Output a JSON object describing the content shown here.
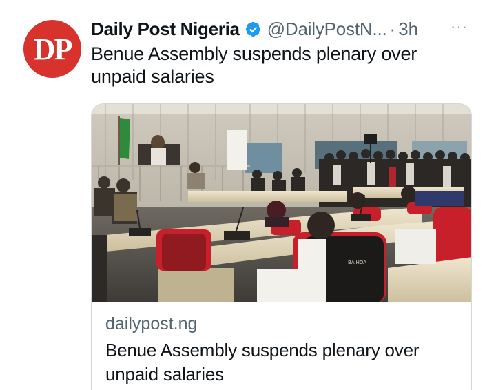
{
  "tweet": {
    "avatar_text": "DP",
    "display_name": "Daily Post Nigeria",
    "handle": "@DailyPostN...",
    "separator": "·",
    "time": "3h",
    "more": "···",
    "text": "Benue Assembly suspends plenary over unpaid salaries"
  },
  "card": {
    "domain": "dailypost.ng",
    "title": "Benue Assembly suspends plenary over unpaid salaries",
    "image_text": "BAIHOA"
  },
  "colors": {
    "avatar_bg": "#d8322c",
    "verified": "#1d9bf0",
    "secondary_text": "#536471",
    "chair_red": "#c8202a"
  },
  "icons": {
    "verified": "verified-badge-icon",
    "more": "more-options-icon"
  }
}
